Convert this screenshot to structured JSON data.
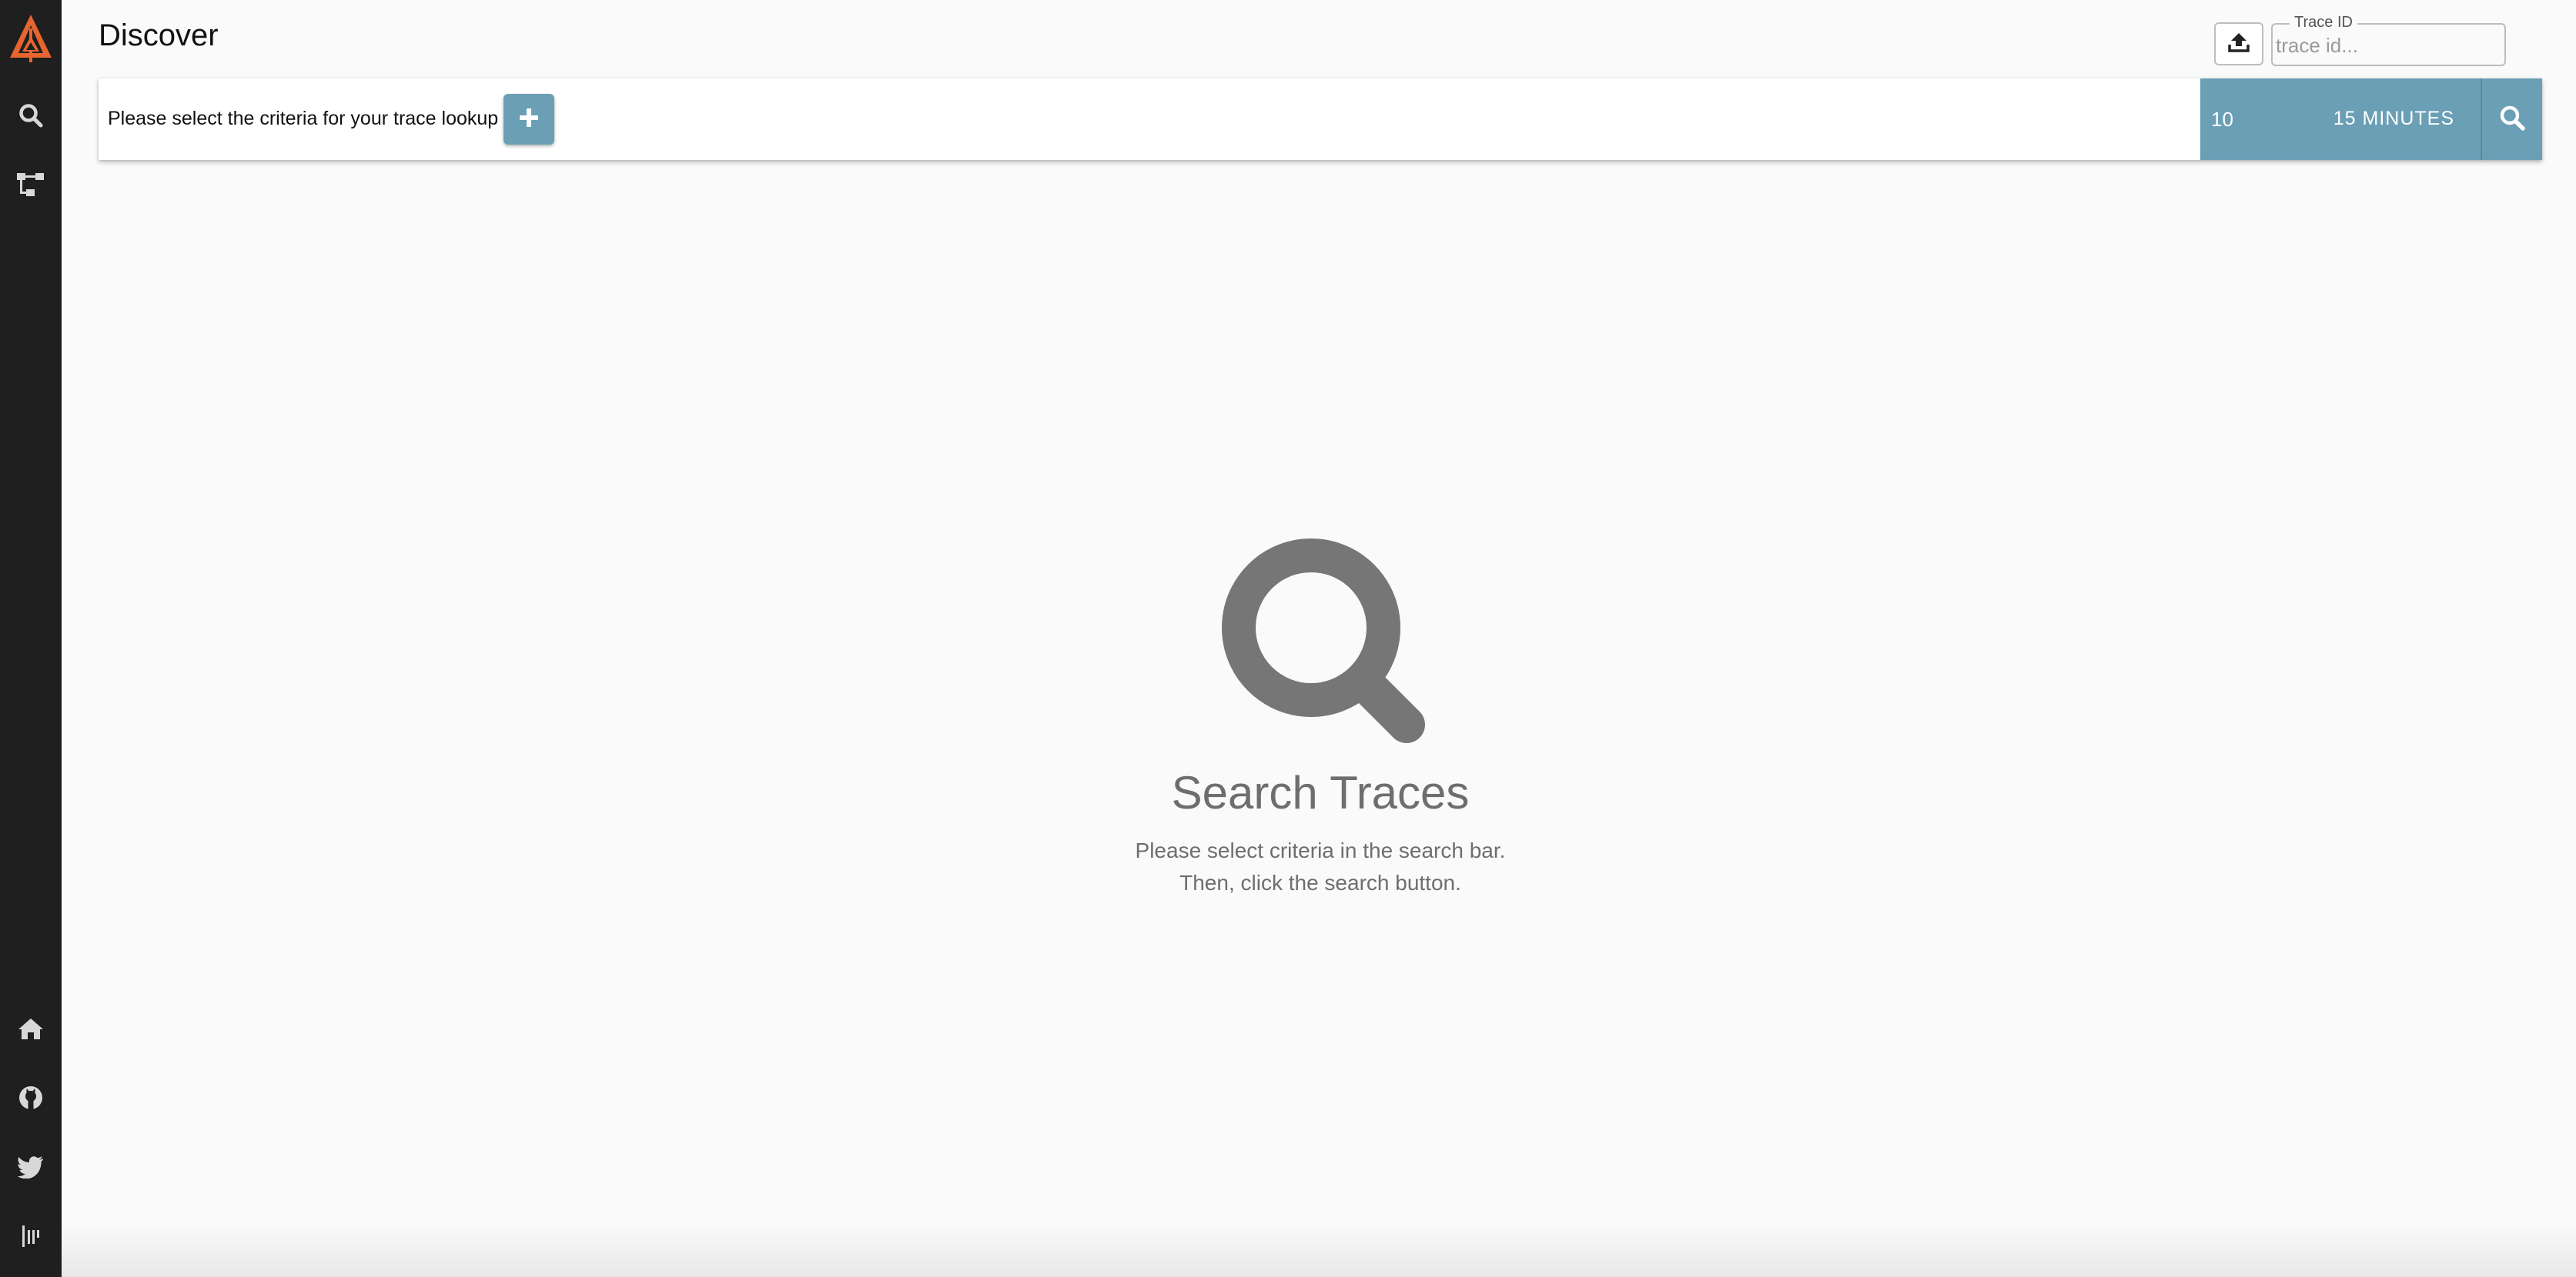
{
  "sidebar": {
    "logo_icon": "zipkin-logo-icon",
    "items": [
      {
        "icon": "search-icon"
      },
      {
        "icon": "dependencies-icon"
      }
    ],
    "footer_items": [
      {
        "icon": "home-icon"
      },
      {
        "icon": "github-icon"
      },
      {
        "icon": "twitter-icon"
      },
      {
        "icon": "gitter-icon"
      }
    ]
  },
  "header": {
    "title": "Discover",
    "upload_icon": "upload-icon",
    "trace_id_label": "Trace ID",
    "trace_id_placeholder": "trace id...",
    "trace_id_value": ""
  },
  "search_bar": {
    "criteria_prompt": "Please select the criteria for your trace lookup",
    "add_icon": "plus-icon",
    "limit": "10",
    "time_range": "15 MINUTES",
    "search_icon": "search-icon"
  },
  "empty_state": {
    "icon": "search-icon",
    "title": "Search Traces",
    "line1": "Please select criteria in the search bar.",
    "line2": "Then, click the search button."
  },
  "colors": {
    "sidebar_bg": "#1f1f1f",
    "accent": "#6a9fb5",
    "logo": "#e8652f",
    "muted_text": "#6e6e6e"
  }
}
